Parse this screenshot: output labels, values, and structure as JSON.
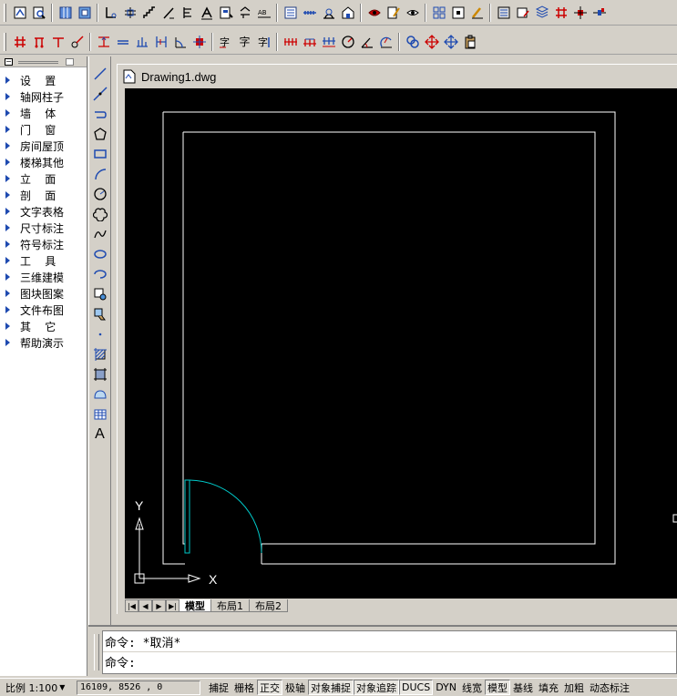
{
  "toolbars": {
    "row1_icons": [
      "drawing-setup-icon",
      "zoom-window-icon",
      "axis-grid-icon",
      "column-icon",
      "wall-offset-icon",
      "wall-join-icon",
      "stair-icon",
      "grid-text-icon",
      "text-label-icon",
      "elevation-icon",
      "dimension-icon",
      "text-style-icon",
      "table-icon",
      "measure-icon",
      "area-icon",
      "room-icon",
      "view-eye-icon",
      "edit-pen-icon",
      "hide-eye-icon",
      "layer-grid-icon",
      "block-icon",
      "paint-brush-icon",
      "layout-icon",
      "properties-icon",
      "layers-icon",
      "hash-icon",
      "align-icon",
      "linetype-icon",
      "color-icon"
    ],
    "row2_icons": [
      "hash-axis-icon",
      "column-grid-icon",
      "t-bar-icon",
      "trim-icon",
      "dimension-vertical-icon",
      "line-equal-icon",
      "baseline-icon",
      "dimension-align-icon",
      "arc-dim-icon",
      "break-icon",
      "text-edit-icon",
      "text-char-icon",
      "text-multi-icon",
      "dim-chain-icon",
      "dim-continue-icon",
      "dim-group-icon",
      "radius-icon",
      "angle-icon",
      "rotate-dim-icon",
      "link-icon",
      "move-icon",
      "pan-icon",
      "paste-icon"
    ],
    "row2_text_glyphs": {
      "text_char": "字",
      "text_multi": "字"
    }
  },
  "left_panel": {
    "minimize_label": "−",
    "items": [
      {
        "label": "设    置"
      },
      {
        "label": "轴网柱子"
      },
      {
        "label": "墙    体"
      },
      {
        "label": "门    窗"
      },
      {
        "label": "房间屋顶"
      },
      {
        "label": "楼梯其他"
      },
      {
        "label": "立    面"
      },
      {
        "label": "剖    面"
      },
      {
        "label": "文字表格"
      },
      {
        "label": "尺寸标注"
      },
      {
        "label": "符号标注"
      },
      {
        "label": "工    具"
      },
      {
        "label": "三维建模"
      },
      {
        "label": "图块图案"
      },
      {
        "label": "文件布图"
      },
      {
        "label": "其    它"
      },
      {
        "label": "帮助演示"
      }
    ]
  },
  "draw_toolbar": {
    "icons": [
      "line-icon",
      "construction-line-icon",
      "polyline-icon",
      "polygon-icon",
      "rectangle-icon",
      "arc-icon",
      "circle-icon",
      "revision-cloud-icon",
      "spline-icon",
      "ellipse-icon",
      "ellipse-arc-icon",
      "insert-block-icon",
      "make-block-icon",
      "point-icon",
      "hatch-icon",
      "gradient-icon",
      "region-icon",
      "table-icon",
      "multiline-text-icon"
    ],
    "text_tool_label": "A"
  },
  "drawing": {
    "filename": "Drawing1.dwg",
    "ucs_x_label": "X",
    "ucs_y_label": "Y",
    "colors": {
      "background": "#000000",
      "walls": "#ffffff",
      "door": "#00c8c8"
    }
  },
  "layout_tabs": {
    "nav_buttons": [
      "|◀",
      "◀",
      "▶",
      "▶|"
    ],
    "tabs": [
      {
        "label": "模型",
        "active": true
      },
      {
        "label": "布局1",
        "active": false
      },
      {
        "label": "布局2",
        "active": false
      }
    ]
  },
  "command": {
    "history_line": "命令: *取消*",
    "prompt_line": "命令:"
  },
  "status_bar": {
    "scale_label": "比例 1:100",
    "coordinates": "16109, 8526 , 0",
    "toggles": [
      {
        "label": "捕捉",
        "on": false
      },
      {
        "label": "栅格",
        "on": false
      },
      {
        "label": "正交",
        "on": true
      },
      {
        "label": "极轴",
        "on": false
      },
      {
        "label": "对象捕捉",
        "on": true
      },
      {
        "label": "对象追踪",
        "on": true
      },
      {
        "label": "DUCS",
        "on": true
      },
      {
        "label": "DYN",
        "on": false
      },
      {
        "label": "线宽",
        "on": false
      },
      {
        "label": "模型",
        "on": true
      },
      {
        "label": "基线",
        "on": false
      },
      {
        "label": "填充",
        "on": false
      },
      {
        "label": "加粗",
        "on": false
      },
      {
        "label": "动态标注",
        "on": false
      }
    ]
  }
}
